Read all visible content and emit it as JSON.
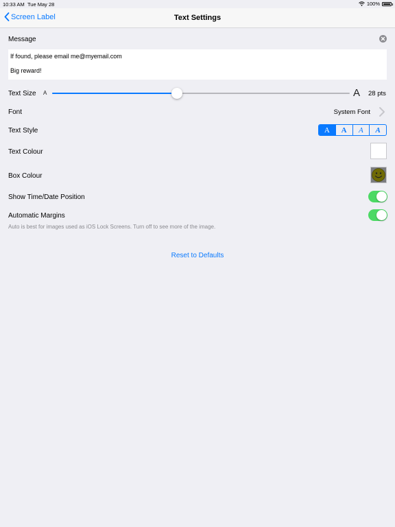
{
  "status_bar": {
    "time": "10:33 AM",
    "date": "Tue May 28",
    "battery": "100%"
  },
  "nav": {
    "back_label": "Screen Label",
    "title": "Text Settings"
  },
  "message": {
    "label": "Message",
    "line1": "If found, please email me@myemail.com",
    "line2": "Big reward!"
  },
  "text_size": {
    "label": "Text Size",
    "small_a": "A",
    "large_a": "A",
    "value": 28,
    "value_label": "28 pts",
    "slider_fraction": 0.42
  },
  "font": {
    "label": "Font",
    "value": "System Font"
  },
  "text_style": {
    "label": "Text Style",
    "options": [
      {
        "glyph": "A",
        "style": "regular",
        "selected": true
      },
      {
        "glyph": "A",
        "style": "bold",
        "selected": false
      },
      {
        "glyph": "A",
        "style": "italic",
        "selected": false
      },
      {
        "glyph": "A",
        "style": "bold-italic",
        "selected": false
      }
    ]
  },
  "text_colour": {
    "label": "Text Colour",
    "color": "#ffffff"
  },
  "box_colour": {
    "label": "Box Colour",
    "color": "#7c7d80",
    "icon": "smiley-icon",
    "icon_color": "#6f6a05"
  },
  "show_time_date": {
    "label": "Show Time/Date Position",
    "on": true
  },
  "automatic_margins": {
    "label": "Automatic Margins",
    "on": true,
    "footnote": "Auto is best for images used as iOS Lock Screens. Turn off to see more of the image."
  },
  "reset": {
    "label": "Reset to Defaults"
  },
  "colors": {
    "accent": "#0a7aff",
    "toggle_on": "#4cd964",
    "background": "#efeff4"
  }
}
